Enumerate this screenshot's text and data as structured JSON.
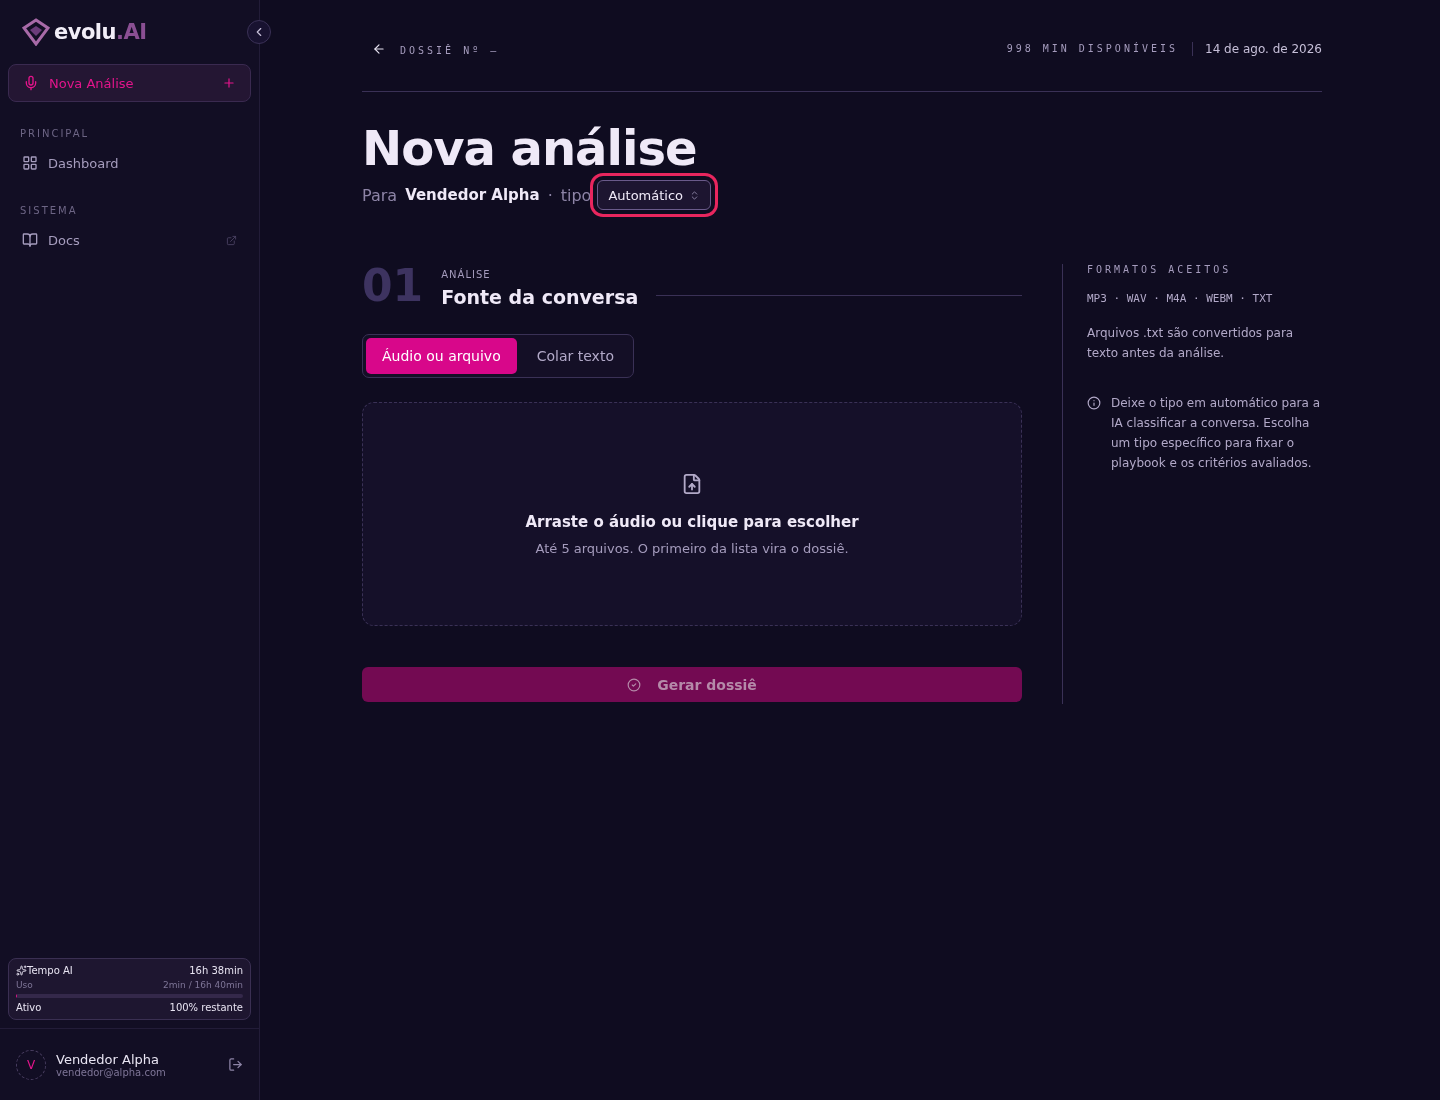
{
  "sidebar": {
    "logo": {
      "name": "evolu",
      "suffix": ".AI"
    },
    "new_button": {
      "label": "Nova Análise",
      "selected": true
    },
    "sections": [
      {
        "title": "PRINCIPAL",
        "items": [
          {
            "label": "Dashboard",
            "kind": "internal"
          }
        ]
      },
      {
        "title": "SISTEMA",
        "items": [
          {
            "label": "Docs",
            "kind": "external"
          }
        ]
      }
    ],
    "usage_card": {
      "title": "Tempo AI",
      "total": "16h 38min",
      "usage_label": "Uso",
      "usage_value": "2min / 16h 40min",
      "level": 0.002,
      "status": "Ativo",
      "remaining": "100% restante"
    },
    "user": {
      "initial": "V",
      "name": "Vendedor Alpha",
      "email": "vendedor@alpha.com"
    }
  },
  "header": {
    "title": "DOSSIÊ Nº —",
    "minutes": "998 MIN DISPONÍVEIS",
    "date": "14 de ago. de 2026"
  },
  "page": {
    "title": "Nova análise",
    "for_label": "Para",
    "for_value": "Vendedor Alpha",
    "separator": "·",
    "type_label": "tipo",
    "type_select": {
      "value": "Automático",
      "focused": true
    }
  },
  "section": {
    "number": "01",
    "eyebrow": "ANÁLISE",
    "title": "Fonte da conversa",
    "tabs": [
      {
        "label": "Áudio ou arquivo",
        "selected": true
      },
      {
        "label": "Colar texto",
        "selected": false
      }
    ],
    "dropzone": {
      "title": "Arraste o áudio ou clique para escolher",
      "hint": "Até 5 arquivos. O primeiro da lista vira o dossiê."
    },
    "submit": {
      "label": "Gerar dossiê",
      "disabled": true
    }
  },
  "aside": {
    "title": "FORMATOS ACEITOS",
    "formats": "MP3 · WAV · M4A · WEBM · TXT",
    "note": "Arquivos .txt são convertidos para texto antes da análise.",
    "info": "Deixe o tipo em automático para a IA classificar a conversa. Escolha um tipo específico para fixar o playbook e os critérios avaliados."
  }
}
